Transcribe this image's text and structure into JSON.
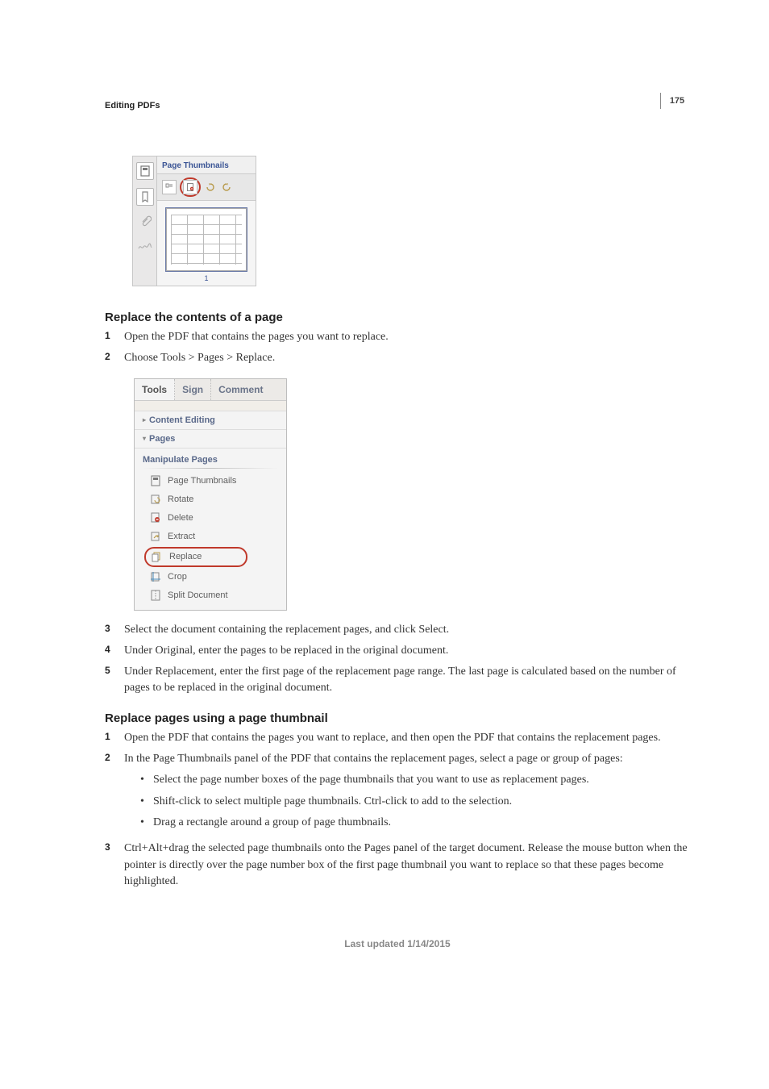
{
  "page_number": "175",
  "section_header": "Editing PDFs",
  "thumbnails_panel": {
    "title": "Page Thumbnails",
    "page_number": "1"
  },
  "heading1": "Replace the contents of a page",
  "steps1": [
    "Open the PDF that contains the pages you want to replace.",
    "Choose Tools > Pages > Replace."
  ],
  "tools_panel": {
    "tabs": [
      "Tools",
      "Sign",
      "Comment"
    ],
    "row_content_editing": "Content Editing",
    "row_pages": "Pages",
    "section_title": "Manipulate Pages",
    "items": [
      "Page Thumbnails",
      "Rotate",
      "Delete",
      "Extract",
      "Replace",
      "Crop",
      "Split Document"
    ]
  },
  "steps1b": [
    "Select the document containing the replacement pages, and click Select.",
    "Under Original, enter the pages to be replaced in the original document.",
    "Under Replacement, enter the first page of the replacement page range. The last page is calculated based on the number of pages to be replaced in the original document."
  ],
  "heading2": "Replace pages using a page thumbnail",
  "steps2": [
    "Open the PDF that contains the pages you want to replace, and then open the PDF that contains the replacement pages.",
    "In the Page Thumbnails panel of the PDF that contains the replacement pages, select a page or group of pages:"
  ],
  "sub2": [
    "Select the page number boxes of the page thumbnails that you want to use as replacement pages.",
    "Shift-click to select multiple page thumbnails. Ctrl-click to add to the selection.",
    "Drag a rectangle around a group of page thumbnails."
  ],
  "step2_3": "Ctrl+Alt+drag the selected page thumbnails onto the Pages panel of the target document. Release the mouse button when the pointer is directly over the page number box of the first page thumbnail you want to replace so that these pages become highlighted.",
  "footer": "Last updated 1/14/2015"
}
